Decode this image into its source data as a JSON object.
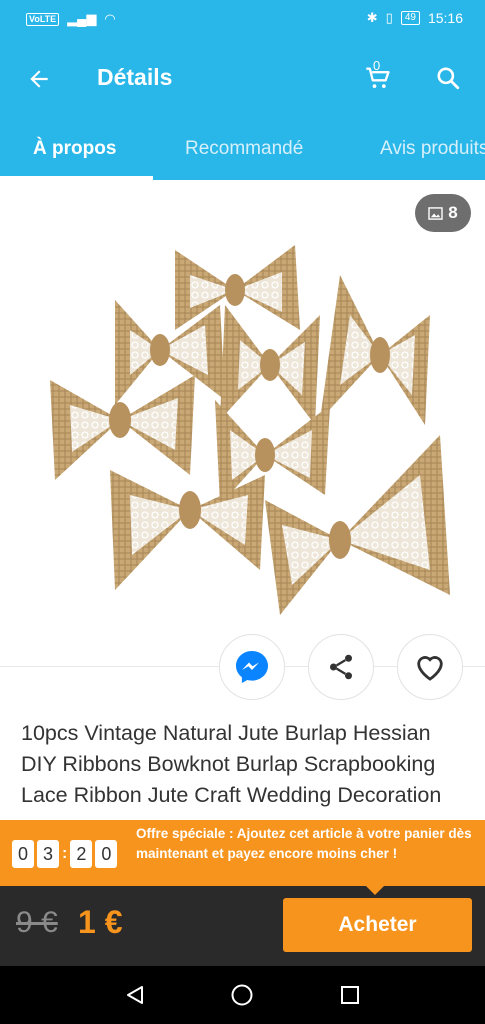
{
  "status_bar": {
    "volte": "VoLTE",
    "network": "4G",
    "time": "15:16",
    "battery": "49"
  },
  "header": {
    "title": "Détails",
    "cart_count": "0",
    "icons": [
      "back-arrow-icon",
      "cart-icon",
      "search-icon"
    ]
  },
  "tabs": [
    {
      "label": "À propos"
    },
    {
      "label": "Recommandé"
    },
    {
      "label": "Avis produits"
    }
  ],
  "gallery": {
    "photo_count": "8"
  },
  "actions": {
    "icons": [
      "messenger-icon",
      "share-icon",
      "heart-icon"
    ]
  },
  "product": {
    "title": "10pcs Vintage Natural Jute Burlap Hessian DIY Ribbons Bowknot Burlap Scrapbooking Lace Ribbon Jute Craft Wedding Decoration"
  },
  "offer": {
    "countdown": [
      "0",
      "3",
      "2",
      "0"
    ],
    "text": "Offre spéciale : Ajoutez cet article à votre panier dès maintenant et payez encore moins cher !"
  },
  "price": {
    "old": "9 €",
    "new": "1 €",
    "buy_label": "Acheter"
  },
  "colors": {
    "primary": "#29b6e8",
    "accent": "#f7941d",
    "price_bar": "#2a2a2a"
  }
}
